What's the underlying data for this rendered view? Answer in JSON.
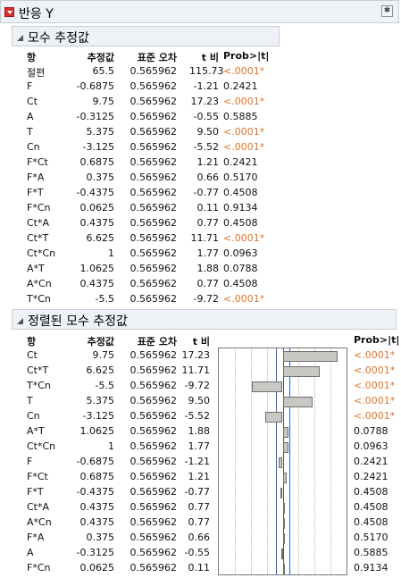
{
  "header": {
    "title": "반응 Y"
  },
  "estimates": {
    "title": "모수 추정값",
    "columns": [
      "항",
      "추정값",
      "표준 오차",
      "t 비",
      "Prob>|t|"
    ],
    "rows": [
      [
        "절편",
        "65.5",
        "0.565962",
        "115.73",
        "<.0001*"
      ],
      [
        "F",
        "-0.6875",
        "0.565962",
        "-1.21",
        "0.2421"
      ],
      [
        "Ct",
        "9.75",
        "0.565962",
        "17.23",
        "<.0001*"
      ],
      [
        "A",
        "-0.3125",
        "0.565962",
        "-0.55",
        "0.5885"
      ],
      [
        "T",
        "5.375",
        "0.565962",
        "9.50",
        "<.0001*"
      ],
      [
        "Cn",
        "-3.125",
        "0.565962",
        "-5.52",
        "<.0001*"
      ],
      [
        "F*Ct",
        "0.6875",
        "0.565962",
        "1.21",
        "0.2421"
      ],
      [
        "F*A",
        "0.375",
        "0.565962",
        "0.66",
        "0.5170"
      ],
      [
        "F*T",
        "-0.4375",
        "0.565962",
        "-0.77",
        "0.4508"
      ],
      [
        "F*Cn",
        "0.0625",
        "0.565962",
        "0.11",
        "0.9134"
      ],
      [
        "Ct*A",
        "0.4375",
        "0.565962",
        "0.77",
        "0.4508"
      ],
      [
        "Ct*T",
        "6.625",
        "0.565962",
        "11.71",
        "<.0001*"
      ],
      [
        "Ct*Cn",
        "1",
        "0.565962",
        "1.77",
        "0.0963"
      ],
      [
        "A*T",
        "1.0625",
        "0.565962",
        "1.88",
        "0.0788"
      ],
      [
        "A*Cn",
        "0.4375",
        "0.565962",
        "0.77",
        "0.4508"
      ],
      [
        "T*Cn",
        "-5.5",
        "0.565962",
        "-9.72",
        "<.0001*"
      ]
    ]
  },
  "sorted": {
    "title": "정렬된 모수 추정값",
    "columns": [
      "항",
      "추정값",
      "표준 오차",
      "t 비",
      "Prob>|t|"
    ],
    "rows": [
      [
        "Ct",
        "9.75",
        "0.565962",
        "17.23",
        "<.0001*"
      ],
      [
        "Ct*T",
        "6.625",
        "0.565962",
        "11.71",
        "<.0001*"
      ],
      [
        "T*Cn",
        "-5.5",
        "0.565962",
        "-9.72",
        "<.0001*"
      ],
      [
        "T",
        "5.375",
        "0.565962",
        "9.50",
        "<.0001*"
      ],
      [
        "Cn",
        "-3.125",
        "0.565962",
        "-5.52",
        "<.0001*"
      ],
      [
        "A*T",
        "1.0625",
        "0.565962",
        "1.88",
        "0.0788"
      ],
      [
        "Ct*Cn",
        "1",
        "0.565962",
        "1.77",
        "0.0963"
      ],
      [
        "F",
        "-0.6875",
        "0.565962",
        "-1.21",
        "0.2421"
      ],
      [
        "F*Ct",
        "0.6875",
        "0.565962",
        "1.21",
        "0.2421"
      ],
      [
        "F*T",
        "-0.4375",
        "0.565962",
        "-0.77",
        "0.4508"
      ],
      [
        "Ct*A",
        "0.4375",
        "0.565962",
        "0.77",
        "0.4508"
      ],
      [
        "A*Cn",
        "0.4375",
        "0.565962",
        "0.77",
        "0.4508"
      ],
      [
        "F*A",
        "0.375",
        "0.565962",
        "0.66",
        "0.5170"
      ],
      [
        "A",
        "-0.3125",
        "0.565962",
        "-0.55",
        "0.5885"
      ],
      [
        "F*Cn",
        "0.0625",
        "0.565962",
        "0.11",
        "0.9134"
      ]
    ]
  },
  "chart_data": {
    "type": "bar",
    "orientation": "horizontal",
    "categories": [
      "Ct",
      "Ct*T",
      "T*Cn",
      "T",
      "Cn",
      "A*T",
      "Ct*Cn",
      "F",
      "F*Ct",
      "F*T",
      "Ct*A",
      "A*Cn",
      "F*A",
      "A",
      "F*Cn"
    ],
    "values": [
      17.23,
      11.71,
      -9.72,
      9.5,
      -5.52,
      1.88,
      1.77,
      -1.21,
      1.21,
      -0.77,
      0.77,
      0.77,
      0.66,
      -0.55,
      0.11
    ],
    "xlim": [
      -20,
      20
    ],
    "reference_lines": [
      -2.12,
      2.12
    ],
    "gridlines": [
      -15,
      -10,
      -5,
      5,
      10,
      15
    ],
    "bar_color": "#c7c7c3",
    "reference_line_color": "#2a5fcc"
  },
  "colors": {
    "significant": "#e0752c",
    "header_bg": "#eef1f6"
  },
  "icons": {
    "menu": "red-triangle-menu-icon",
    "disclosure": "disclosure-triangle-icon",
    "settings": "settings-icon"
  }
}
